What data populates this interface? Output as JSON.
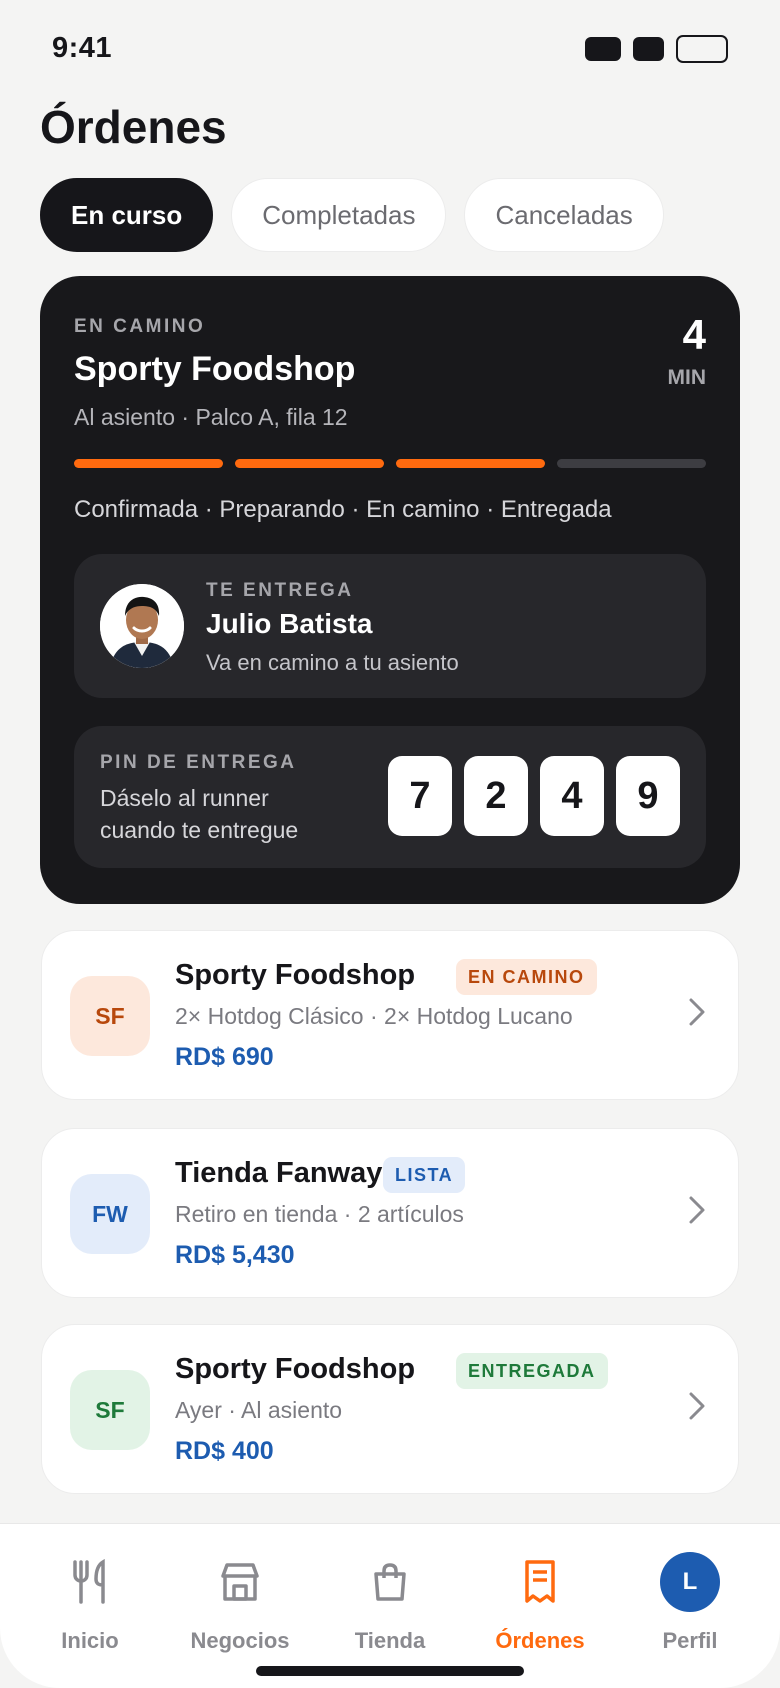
{
  "status_bar": {
    "time": "9:41"
  },
  "page": {
    "title": "Órdenes"
  },
  "tabs": [
    {
      "label": "En curso",
      "active": true
    },
    {
      "label": "Completadas",
      "active": false
    },
    {
      "label": "Canceladas",
      "active": false
    }
  ],
  "active_order": {
    "status": "EN CAMINO",
    "store": "Sporty Foodshop",
    "location": "Al asiento · Palco A, fila 12",
    "eta_value": "4",
    "eta_unit": "MIN",
    "progress_completed_steps": 3,
    "progress_total_steps": 4,
    "steps_text": "Confirmada · Preparando · En camino · Entregada",
    "runner": {
      "label": "TE ENTREGA",
      "name": "Julio Batista",
      "subtitle": "Va en camino a tu asiento"
    },
    "pin": {
      "label": "PIN DE ENTREGA",
      "subtitle": "Dáselo al runner cuando te entregue",
      "digits": [
        "7",
        "2",
        "4",
        "9"
      ]
    }
  },
  "orders": [
    {
      "monogram": "SF",
      "name": "Sporty Foodshop",
      "badge": "EN CAMINO",
      "detail": "2× Hotdog Clásico · 2× Hotdog Lucano",
      "price": "RD$ 690",
      "colors": {
        "mono_bg": "#fde8dc",
        "mono_fg": "#b8480c",
        "badge_bg": "#fde8dc",
        "badge_fg": "#b8480c"
      }
    },
    {
      "monogram": "FW",
      "name": "Tienda Fanway",
      "badge": "LISTA",
      "detail": "Retiro en tienda · 2 artículos",
      "price": "RD$ 5,430",
      "colors": {
        "mono_bg": "#e3ecfa",
        "mono_fg": "#1d5cb0",
        "badge_bg": "#e3ecfa",
        "badge_fg": "#1d5cb0"
      }
    },
    {
      "monogram": "SF",
      "name": "Sporty Foodshop",
      "badge": "ENTREGADA",
      "detail": "Ayer · Al asiento",
      "price": "RD$ 400",
      "colors": {
        "mono_bg": "#e2f3e6",
        "mono_fg": "#1e7a3a",
        "badge_bg": "#e2f3e6",
        "badge_fg": "#1e7a3a"
      }
    }
  ],
  "nav": [
    {
      "label": "Inicio",
      "icon": "utensils-icon",
      "active": false
    },
    {
      "label": "Negocios",
      "icon": "store-icon",
      "active": false
    },
    {
      "label": "Tienda",
      "icon": "shopping-bag-icon",
      "active": false
    },
    {
      "label": "Órdenes",
      "icon": "receipt-icon",
      "active": true
    },
    {
      "label": "Perfil",
      "icon": "avatar-icon",
      "active": false,
      "initial": "L"
    }
  ],
  "colors": {
    "accent": "#ff6a0f",
    "dark_card": "#18181b",
    "price_blue": "#1d5cb0"
  }
}
